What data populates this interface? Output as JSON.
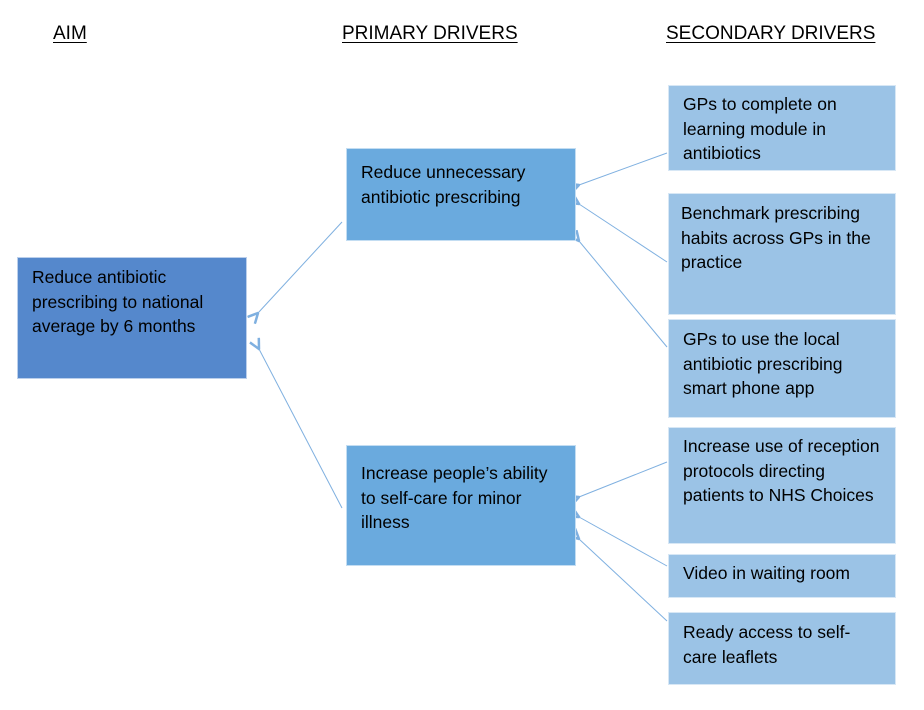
{
  "headers": {
    "aim": "AIM",
    "primary": "PRIMARY DRIVERS",
    "secondary": "SECONDARY DRIVERS"
  },
  "aim": {
    "text": "Reduce antibiotic prescribing to national average by 6 months"
  },
  "primary_drivers": [
    {
      "text": "Reduce unnecessary antibiotic prescribing"
    },
    {
      "text": "Increase people’s ability to self-care for minor illness"
    }
  ],
  "secondary_drivers": [
    {
      "text": "GPs to complete on learning module in antibiotics",
      "drives": 0
    },
    {
      "text": "Benchmark prescribing habits across GPs in the practice",
      "drives": 0
    },
    {
      "text": "GPs to use the local antibiotic prescribing smart phone app",
      "drives": 0
    },
    {
      "text": "Increase use of reception protocols directing patients to NHS Choices",
      "drives": 1
    },
    {
      "text": "Video in waiting room",
      "drives": 1
    },
    {
      "text": "Ready access to self-care leaflets",
      "drives": 1
    }
  ],
  "colors": {
    "aim": "#5588cc",
    "primary": "#6aaade",
    "secondary": "#9bc3e6",
    "arrow": "#7fb0e0"
  }
}
